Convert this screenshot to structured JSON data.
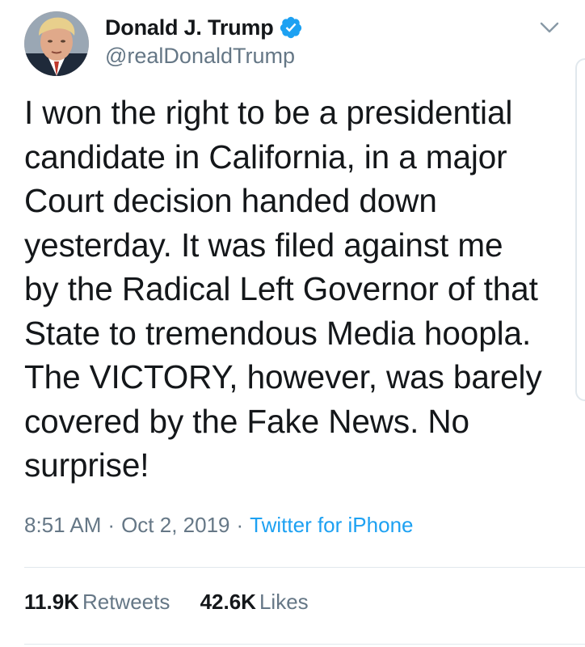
{
  "author": {
    "display_name": "Donald J. Trump",
    "handle": "@realDonaldTrump",
    "verified": true,
    "avatar_icon": "profile-photo"
  },
  "tweet": {
    "text_lines": [
      "I won the right to be a presidential",
      "candidate in California, in a major",
      "Court decision handed down",
      "yesterday. It was filed against me",
      "by the Radical Left Governor of that",
      "State to tremendous Media hoopla.",
      "The VICTORY, however, was barely",
      "covered by the Fake News. No",
      "surprise!"
    ],
    "time": "8:51 AM",
    "separator": "·",
    "date": "Oct 2, 2019",
    "source": "Twitter for iPhone"
  },
  "stats": {
    "retweets_count": "11.9K",
    "retweets_label": "Retweets",
    "likes_count": "42.6K",
    "likes_label": "Likes"
  },
  "colors": {
    "text": "#14171a",
    "secondary": "#657786",
    "accent": "#1da1f2",
    "divider": "#e1e8ed"
  },
  "icons": {
    "verified": "verified-badge-icon",
    "menu": "chevron-down-icon"
  }
}
